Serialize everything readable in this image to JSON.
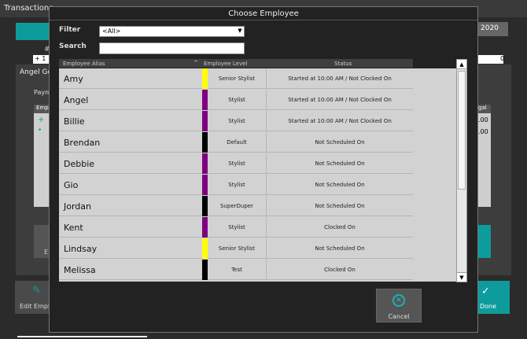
{
  "background": {
    "app_title": "Transactions",
    "date_fragment": "2020",
    "header_col": "#",
    "row_prefix": "+ 1",
    "row_right": "0",
    "panel_title": "Angel Goo",
    "payment_label": "Paym",
    "grid_header": "Emp",
    "grid_header_right": "gal",
    "grid_values": [
      ".00",
      ".00"
    ],
    "edit_button_label": "Edit Employ",
    "button_left_label": "E",
    "done_button_label": "Done"
  },
  "modal": {
    "title": "Choose Employee",
    "filter_label": "Filter",
    "filter_value": "<All>",
    "search_label": "Search",
    "search_value": "",
    "columns": [
      "Employee Alias",
      "Employee Level",
      "Status"
    ],
    "cancel_label": "Cancel"
  },
  "employees": [
    {
      "alias": "Amy",
      "level": "Senior Stylist",
      "color": "#ffff00",
      "status": "Started at 10:00 AM / Not Clocked On"
    },
    {
      "alias": "Angel",
      "level": "Stylist",
      "color": "#7d0080",
      "status": "Started at 10:00 AM / Not Clocked On"
    },
    {
      "alias": "Billie",
      "level": "Stylist",
      "color": "#7d0080",
      "status": "Started at 10:00 AM / Not Clocked On"
    },
    {
      "alias": "Brendan",
      "level": "Default",
      "color": "#000000",
      "status": "Not Scheduled On"
    },
    {
      "alias": "Debbie",
      "level": "Stylist",
      "color": "#7d0080",
      "status": "Not Scheduled On"
    },
    {
      "alias": "Gio",
      "level": "Stylist",
      "color": "#7d0080",
      "status": "Not Scheduled On"
    },
    {
      "alias": "Jordan",
      "level": "SuperDuper",
      "color": "#000000",
      "status": "Not Scheduled On"
    },
    {
      "alias": "Kent",
      "level": "Stylist",
      "color": "#7d0080",
      "status": "Clocked On"
    },
    {
      "alias": "Lindsay",
      "level": "Senior Stylist",
      "color": "#ffff00",
      "status": "Not Scheduled On"
    },
    {
      "alias": "Melissa",
      "level": "Test",
      "color": "#000000",
      "status": "Clocked On"
    }
  ],
  "colors": {
    "accent": "#0e9b9c",
    "list_background": "#d2d2d2",
    "modal_background": "#222222"
  },
  "icons": {
    "sort": "sort-up-icon",
    "scroll_up": "arrow-up-icon",
    "scroll_down": "arrow-down-icon",
    "dropdown": "chevron-down-icon",
    "cancel": "cancel-circle-icon",
    "edit": "pencil-icon",
    "done": "check-icon"
  }
}
